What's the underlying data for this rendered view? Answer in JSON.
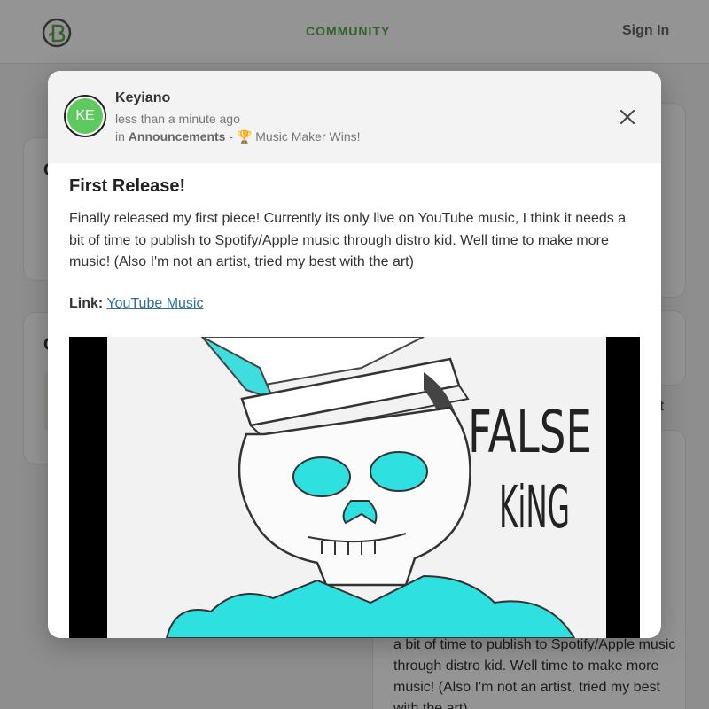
{
  "nav": {
    "community": "COMMUNITY",
    "sign_in": "Sign In"
  },
  "background": {
    "card1_letter": "C",
    "card2_letter": "C",
    "partial_word": "st",
    "post_text_fragment": "a bit of time to publish to Spotify/Apple music through distro kid. Well time to make more music! (Also I'm not an artist, tried my best with the art)"
  },
  "post": {
    "author": "Keyiano",
    "avatar_initials": "KE",
    "time": "less than a minute ago",
    "category_prefix": "in ",
    "category": "Announcements",
    "separator": " - ",
    "trophy_icon": "🏆",
    "subcategory": "Music Maker Wins!",
    "title": "First Release!",
    "body": "Finally released my first piece! Currently its only live on YouTube music, I think it needs a bit of time to publish to Spotify/Apple music through distro kid. Well time to make more music! (Also I'm not an artist, tried my best with the art)",
    "link_label": "Link:",
    "link_text": "YouTube Music",
    "artwork_text_line1": "FALSE",
    "artwork_text_line2": "KiNG"
  },
  "colors": {
    "accent_green": "#5aa84f",
    "avatar_green": "#5ec95e",
    "link_blue": "#2f6fa3",
    "art_cyan": "#2fe0e0"
  },
  "icons": {
    "logo": "brand-logo-icon",
    "close": "close-icon",
    "trophy": "trophy-icon"
  }
}
